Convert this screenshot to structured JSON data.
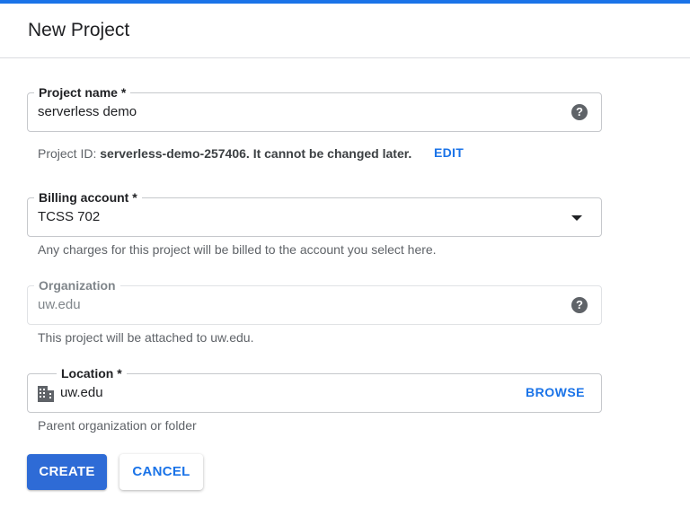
{
  "header": {
    "title": "New Project"
  },
  "project_name": {
    "label": "Project name *",
    "value": "serverless demo",
    "help_icon": "help-icon"
  },
  "project_id": {
    "prefix": "Project ID:",
    "id": "serverless-demo-257406.",
    "suffix": "It cannot be changed later.",
    "edit_label": "EDIT"
  },
  "billing": {
    "label": "Billing account *",
    "value": "TCSS 702",
    "hint": "Any charges for this project will be billed to the account you select here."
  },
  "organization": {
    "label": "Organization",
    "value": "uw.edu",
    "hint": "This project will be attached to uw.edu.",
    "help_icon": "help-icon"
  },
  "location": {
    "label": "Location *",
    "value": "uw.edu",
    "browse_label": "BROWSE",
    "hint": "Parent organization or folder",
    "icon": "building-icon"
  },
  "actions": {
    "create_label": "CREATE",
    "cancel_label": "CANCEL"
  },
  "colors": {
    "accent": "#1a73e8",
    "primary_button": "#2e6bd6"
  }
}
